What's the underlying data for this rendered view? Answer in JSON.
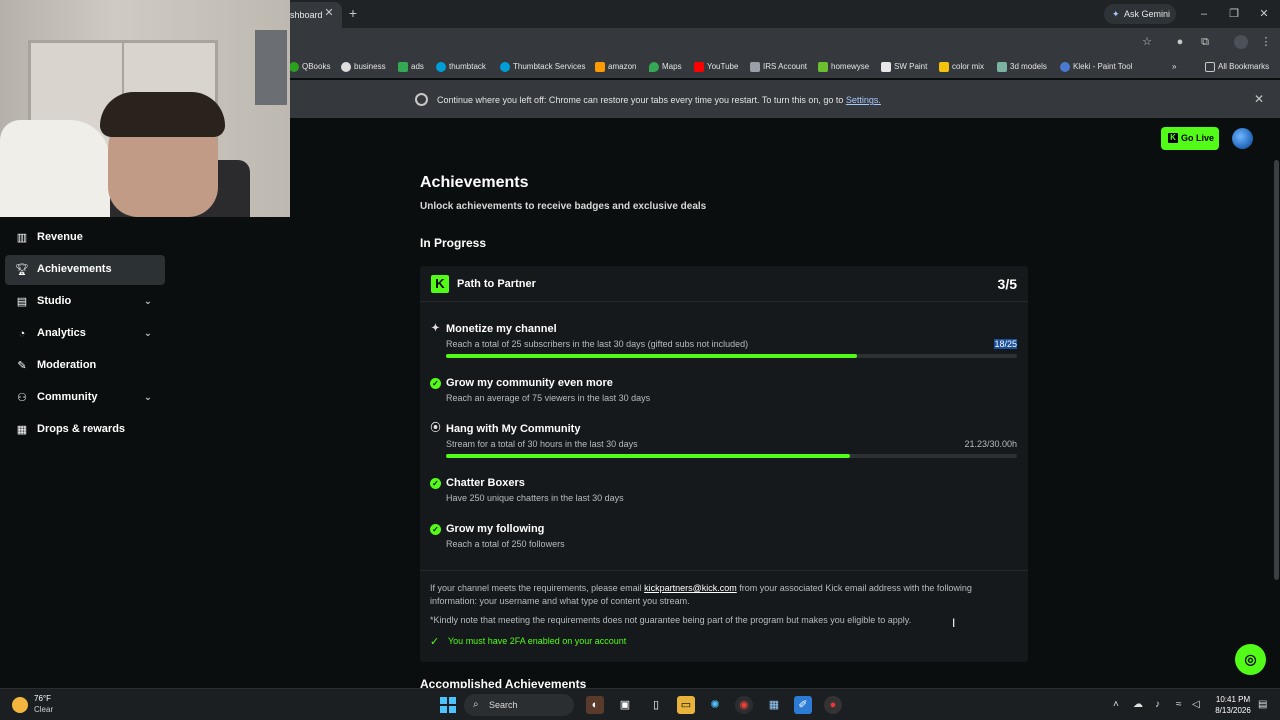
{
  "browser": {
    "tab_title": "shboard",
    "ask_gemini": "Ask Gemini",
    "bookmarks": [
      {
        "label": "QBooks",
        "color": "#2ca01c"
      },
      {
        "label": "business",
        "color": "#dddddd"
      },
      {
        "label": "ads",
        "color": "#34a853"
      },
      {
        "label": "thumbtack",
        "color": "#009fd9"
      },
      {
        "label": "Thumbtack Services",
        "color": "#009fd9"
      },
      {
        "label": "amazon",
        "color": "#ff9900"
      },
      {
        "label": "Maps",
        "color": "#34a853"
      },
      {
        "label": "YouTube",
        "color": "#ff0000"
      },
      {
        "label": "IRS Account",
        "color": "#9aa0a6"
      },
      {
        "label": "homewyse",
        "color": "#6cbf2f"
      },
      {
        "label": "SW Paint",
        "color": "#e8e8e8"
      },
      {
        "label": "color mix",
        "color": "#f4c20d"
      },
      {
        "label": "3d models",
        "color": "#7bb3a0"
      },
      {
        "label": "Kleki - Paint Tool",
        "color": "#4a7bd0"
      }
    ],
    "all_bookmarks": "All Bookmarks",
    "infobar_text": "Continue where you left off: Chrome can restore your tabs every time you restart. To turn this on, go to ",
    "infobar_link": "Settings."
  },
  "sidebar": {
    "items": [
      {
        "label": "Revenue",
        "icon": "chart-icon"
      },
      {
        "label": "Achievements",
        "icon": "trophy-icon",
        "active": true
      },
      {
        "label": "Studio",
        "icon": "studio-icon",
        "chevron": true
      },
      {
        "label": "Analytics",
        "icon": "analytics-icon",
        "chevron": true
      },
      {
        "label": "Moderation",
        "icon": "wrench-icon"
      },
      {
        "label": "Community",
        "icon": "community-icon",
        "chevron": true
      },
      {
        "label": "Drops & rewards",
        "icon": "gift-icon"
      }
    ]
  },
  "header": {
    "go_live": "Go Live"
  },
  "main": {
    "title": "Achievements",
    "subtitle": "Unlock achievements to receive badges and exclusive deals",
    "in_progress": "In Progress",
    "accomplished": "Accomplished Achievements",
    "card": {
      "title": "Path to Partner",
      "count": "3/5",
      "tasks": [
        {
          "title": "Monetize my channel",
          "desc": "Reach a total of 25 subscribers in the last 30 days (gifted subs not included)",
          "progress": "18/25",
          "fraction": 0.72,
          "done": false,
          "icon": "sparkle-icon"
        },
        {
          "title": "Grow my community even more",
          "desc": "Reach an average of 75 viewers in the last 30 days",
          "done": true
        },
        {
          "title": "Hang with My Community",
          "desc": "Stream for a total of 30 hours in the last 30 days",
          "progress": "21.23/30.00h",
          "fraction": 0.7077,
          "done": false,
          "icon": "broadcast-icon"
        },
        {
          "title": "Chatter Boxers",
          "desc": "Have 250 unique chatters in the last 30 days",
          "done": true
        },
        {
          "title": "Grow my following",
          "desc": "Reach a total of 250 followers",
          "done": true
        }
      ],
      "note1_a": "If your channel meets the requirements, please email ",
      "note1_link": "kickpartners@kick.com",
      "note1_b": " from your associated Kick email address with the following information: your username and what type of content you stream.",
      "note2": "*Kindly note that meeting the requirements does not guarantee being part of the program but makes you eligible to apply.",
      "tfa": "You must have 2FA enabled on your account"
    }
  },
  "taskbar": {
    "temp": "76°F",
    "condition": "Clear",
    "search": "Search",
    "time": "10:41 PM",
    "date": "8/13/2026"
  },
  "colors": {
    "accent": "#53fc18",
    "background": "#0b0e0f",
    "card": "#16191b"
  }
}
